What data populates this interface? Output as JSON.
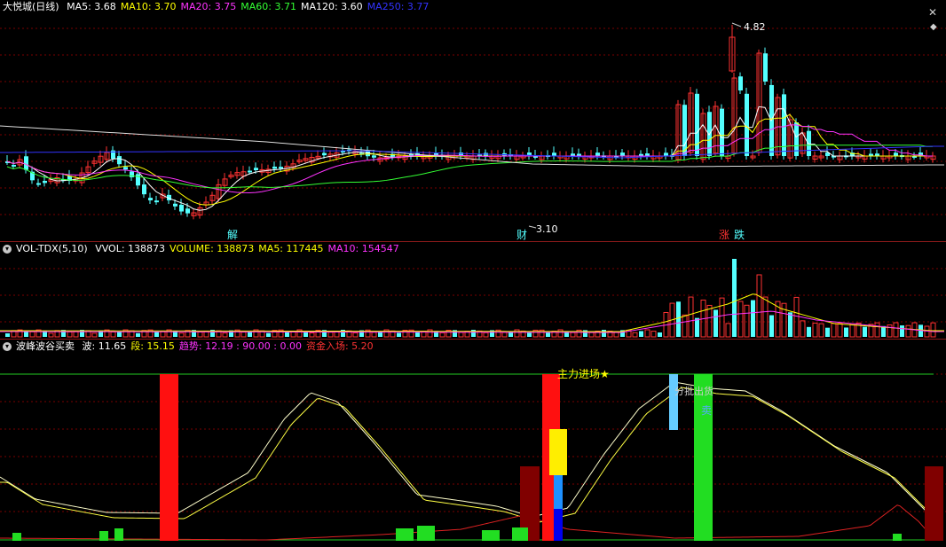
{
  "main_panel": {
    "title": "大悦城(日线)",
    "indicators": [
      {
        "label": "MA5: 3.68",
        "color": "#ffffff"
      },
      {
        "label": "MA10: 3.70",
        "color": "#ffff00"
      },
      {
        "label": "MA20: 3.75",
        "color": "#ff33ff"
      },
      {
        "label": "MA60: 3.71",
        "color": "#33ff33"
      },
      {
        "label": "MA120: 3.60",
        "color": "#ffffff"
      },
      {
        "label": "MA250: 3.77",
        "color": "#3333ff"
      }
    ],
    "high_label": "4.82",
    "low_label": "3.10",
    "markers": {
      "jie": "解",
      "cai": "财",
      "zhang": "涨",
      "die": "跌"
    },
    "close_icon": "close-icon",
    "diamond_icon": "diamond-icon"
  },
  "volume_panel": {
    "title": "VOL-TDX(5,10)",
    "indicators": [
      {
        "label": "VVOL: 138873",
        "color": "#ffffff"
      },
      {
        "label": "VOLUME: 138873",
        "color": "#ffff00"
      },
      {
        "label": "MA5: 117445",
        "color": "#ffff00"
      },
      {
        "label": "MA10: 154547",
        "color": "#ff33ff"
      }
    ]
  },
  "wave_panel": {
    "title": "波峰波谷买卖",
    "indicators": [
      {
        "label": "波: 11.65",
        "color": "#ffffff"
      },
      {
        "label": "段: 15.15",
        "color": "#ffff00"
      },
      {
        "label": "趋势: 12.19 : 90.00 : 0.00",
        "color": "#ff33ff"
      },
      {
        "label": "资金入场: 5.20",
        "color": "#ff3333"
      }
    ],
    "annotations": {
      "main_entry": "主力进场★",
      "batch_out": "分批出货",
      "sell": "卖"
    }
  },
  "colors": {
    "up": "#ff3232",
    "down": "#54ffff",
    "grid": "#7a0000",
    "separator": "#8b1a1a",
    "green_bar": "#22dd22",
    "red_bar": "#ff1010",
    "dark_red_bar": "#800000",
    "yellow_bar": "#ffee00",
    "blue_bar": "#1e90ff",
    "navy_bar": "#0000ee",
    "light_blue_bar": "#66ccff"
  }
}
